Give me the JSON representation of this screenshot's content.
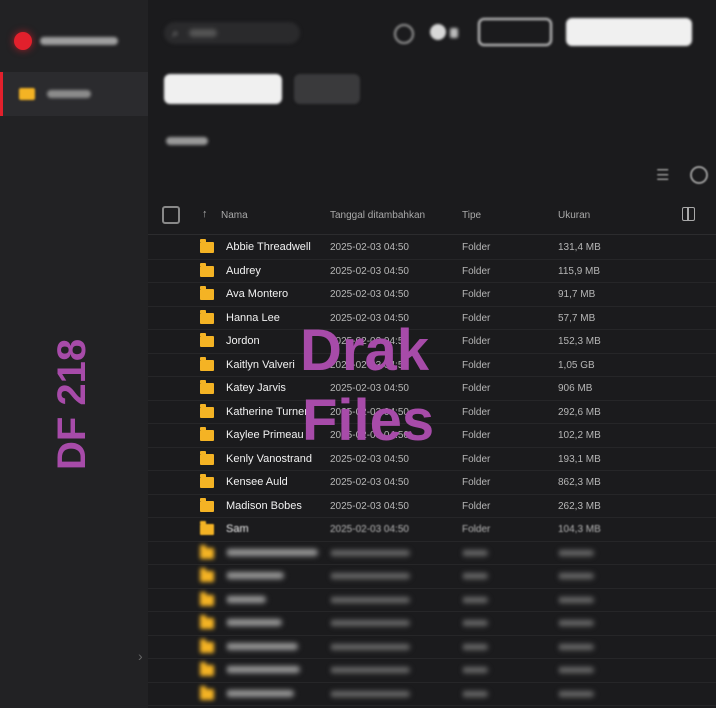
{
  "table": {
    "columns": {
      "name": "Nama",
      "date": "Tanggal ditambahkan",
      "type": "Tipe",
      "size": "Ukuran"
    },
    "rows": [
      {
        "name": "Abbie Threadwell",
        "date": "2025-02-03 04:50",
        "type": "Folder",
        "size": "131,4 MB"
      },
      {
        "name": "Audrey",
        "date": "2025-02-03 04:50",
        "type": "Folder",
        "size": "115,9 MB"
      },
      {
        "name": "Ava Montero",
        "date": "2025-02-03 04:50",
        "type": "Folder",
        "size": "91,7 MB"
      },
      {
        "name": "Hanna Lee",
        "date": "2025-02-03 04:50",
        "type": "Folder",
        "size": "57,7 MB"
      },
      {
        "name": "Jordon",
        "date": "2025-02-03 04:50",
        "type": "Folder",
        "size": "152,3 MB"
      },
      {
        "name": "Kaitlyn Valveri",
        "date": "2025-02-03 04:50",
        "type": "Folder",
        "size": "1,05 GB"
      },
      {
        "name": "Katey Jarvis",
        "date": "2025-02-03 04:50",
        "type": "Folder",
        "size": "906 MB"
      },
      {
        "name": "Katherine Turner",
        "date": "2025-02-03 04:50",
        "type": "Folder",
        "size": "292,6 MB"
      },
      {
        "name": "Kaylee Primeau",
        "date": "2025-02-03 04:50",
        "type": "Folder",
        "size": "102,2 MB"
      },
      {
        "name": "Kenly Vanostrand",
        "date": "2025-02-03 04:50",
        "type": "Folder",
        "size": "193,1 MB"
      },
      {
        "name": "Kensee Auld",
        "date": "2025-02-03 04:50",
        "type": "Folder",
        "size": "862,3 MB"
      },
      {
        "name": "Madison Bobes",
        "date": "2025-02-03 04:50",
        "type": "Folder",
        "size": "262,3 MB"
      },
      {
        "name": "Sam",
        "date": "2025-02-03 04:50",
        "type": "Folder",
        "size": "104,3 MB"
      }
    ],
    "blurred_row_count": 7
  },
  "watermark": {
    "line1": "Drak",
    "line2": "Files",
    "side": "DF 218"
  },
  "colors": {
    "accent": "#e2202c",
    "folder": "#f4b324",
    "watermark": "#a74ba9"
  },
  "icons": [
    "search-icon",
    "help-icon",
    "folder-icon",
    "sort-up-icon",
    "list-view-icon",
    "info-icon",
    "columns-icon",
    "chevron-right-icon"
  ]
}
